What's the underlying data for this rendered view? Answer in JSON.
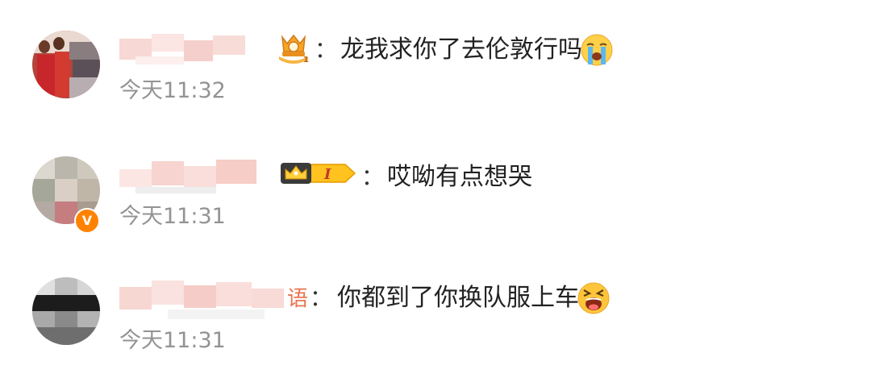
{
  "comments": [
    {
      "name_suffix": "",
      "badge": "trophy-1-badge",
      "colon": "：",
      "text": "龙我求你了去伦敦行吗",
      "emoji": "crying-face-emoji",
      "time": "今天11:32"
    },
    {
      "name_suffix": "",
      "badge": "crown-level-i-badge",
      "badge_label": "I",
      "colon": "：",
      "text": "哎呦有点想哭",
      "time": "今天11:31",
      "verified": "V"
    },
    {
      "name_suffix": "语",
      "colon": "：",
      "text": "你都到了你换队服上车",
      "emoji": "screaming-crying-face-emoji",
      "time": "今天11:31"
    }
  ],
  "colors": {
    "time": "#939393",
    "name_tint": "#eb7350",
    "vip_orange": "#ff8200"
  }
}
